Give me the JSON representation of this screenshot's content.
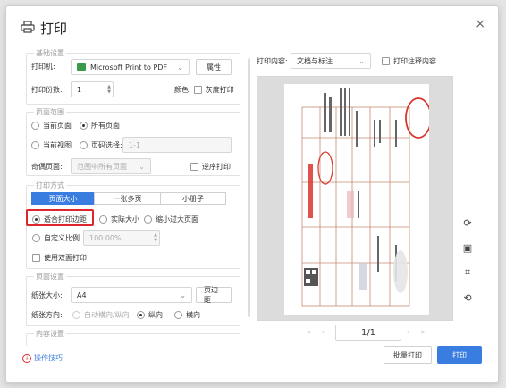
{
  "dialog": {
    "title": "打印",
    "close_glyph": "×",
    "printer_icon": "printer-icon"
  },
  "basic": {
    "group_label": "基础设置",
    "printer_label": "打印机:",
    "printer_value": "Microsoft Print to PDF",
    "properties_button": "属性",
    "copies_label": "打印份数:",
    "copies_value": "1",
    "color_label": "颜色:",
    "grayscale_label": "灰度打印"
  },
  "range": {
    "group_label": "页面范围",
    "current_page": "当前页面",
    "all_pages": "所有页面",
    "current_view": "当前视图",
    "page_select": "页码选择:",
    "page_select_placeholder": "1-1",
    "odd_even_label": "奇偶页面:",
    "odd_even_value": "范围中所有页面",
    "reverse_label": "逆序打印"
  },
  "mode": {
    "group_label": "打印方式",
    "tabs": [
      "页面大小",
      "一张多页",
      "小册子"
    ],
    "fit_margin": "适合打印边距",
    "actual_size": "实际大小",
    "shrink_large": "缩小过大页面",
    "custom_scale": "自定义比例",
    "scale_value": "100.00%",
    "duplex": "使用双面打印"
  },
  "page_setup": {
    "group_label": "页面设置",
    "paper_size_label": "纸张大小:",
    "paper_size_value": "A4",
    "margin_button": "页边距",
    "orientation_label": "纸张方向:",
    "auto_orientation": "自动横向/纵向",
    "portrait": "纵向",
    "landscape": "横向"
  },
  "content": {
    "group_label": "内容设置"
  },
  "top_right": {
    "print_content_label": "打印内容:",
    "print_content_value": "文档与标注",
    "print_annotations": "打印注释内容"
  },
  "pager": {
    "value": "1/1"
  },
  "footer": {
    "tips": "操作技巧",
    "batch_print": "批量打印",
    "print": "打印"
  },
  "colors": {
    "accent": "#3a7de0",
    "highlight": "#e0262d",
    "stamp": "#d9352b",
    "paper_lines": "#c78a72"
  }
}
